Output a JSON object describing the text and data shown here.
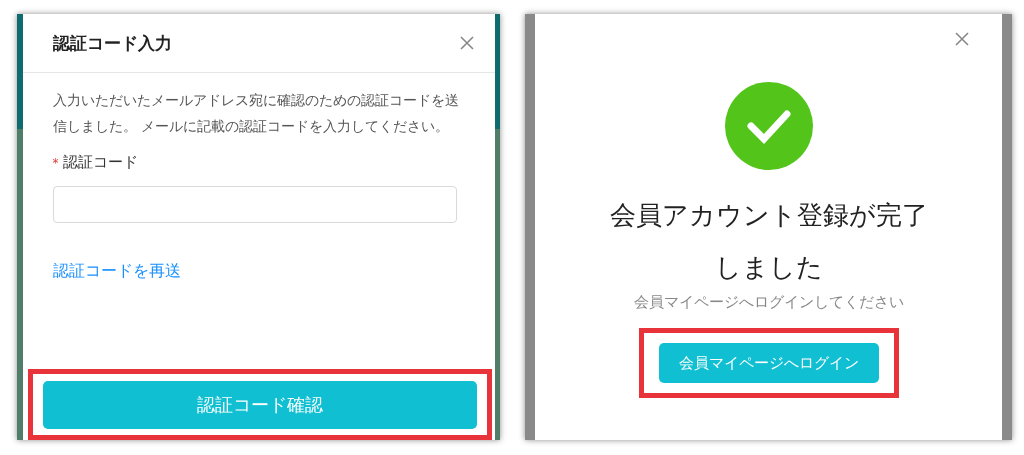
{
  "screens": [
    {
      "kind": "code_entry",
      "title": "認証コード入力",
      "message": "入力いただいたメールアドレス宛に確認のための認証コードを送信しました。 メールに記載の認証コードを入力してください。",
      "field": {
        "label": "認証コード",
        "required_mark": "*"
      },
      "resend_link": "認証コードを再送",
      "button": {
        "label": "認証コード確認",
        "highlighted": true
      }
    },
    {
      "kind": "completion",
      "title": "会員アカウント登録が完了しました",
      "message": "会員マイページへログインしてください",
      "button": {
        "label": "会員マイページへログイン",
        "highlighted": true
      }
    }
  ]
}
